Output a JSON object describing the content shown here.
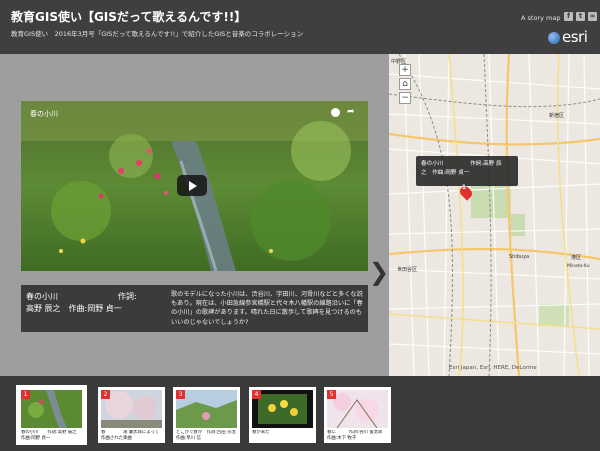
{
  "header": {
    "title": "教育GIS使い【GISだって歌えるんです!!】",
    "subtitle": "教育GIS使い　2016年3月号「GISだって歌えるんです!!」で紹介したGISと音楽のコラボレーション",
    "storymap_label": "A story map",
    "share_icons": [
      "facebook-icon",
      "twitter-icon",
      "link-icon"
    ],
    "brand": "esri"
  },
  "video": {
    "title": "春の小川"
  },
  "caption": {
    "song": "春の小川",
    "lyric_label": "作詞:",
    "artist_line": "高野 辰之　作曲:岡野 貞一",
    "description": "歌のモデルになった小川は、渋谷川、宇田川、河骨川などと多くな説もあり。現在は、小田急線参宮橋駅と代々木八幡駅の線路沿いに「春の小川」の歌碑があります。晴れた日に散歩して歌碑を見つけるのもいいのじゃないでしょうか?"
  },
  "map": {
    "popup_song": "春の小川",
    "popup_right": "作詞:高野 辰",
    "popup_line2": "之　作曲:岡野 貞一",
    "marker_number": "1",
    "attribution": "Esri Japan, Esri, HERE, DeLorme",
    "labels": [
      "中野区",
      "新宿区",
      "渋谷区",
      "港区",
      "世田谷区",
      "Shinjuku",
      "Shibuya",
      "Minato-Ku"
    ]
  },
  "thumbnails": [
    {
      "number": "1",
      "caption": "春の小川　　作詞:高野 辰之 作曲:岡野 貞一"
    },
    {
      "number": "2",
      "caption": "春　　　　滝 廉太郎によって作曲された楽曲"
    },
    {
      "number": "3",
      "caption": "どこかで春が　作詞:百田 宗治 作曲:草川 信"
    },
    {
      "number": "4",
      "caption": "春が来た"
    },
    {
      "number": "5",
      "caption": "春に　　　作詞:谷川 俊太郎 作曲:木下 牧子"
    }
  ]
}
